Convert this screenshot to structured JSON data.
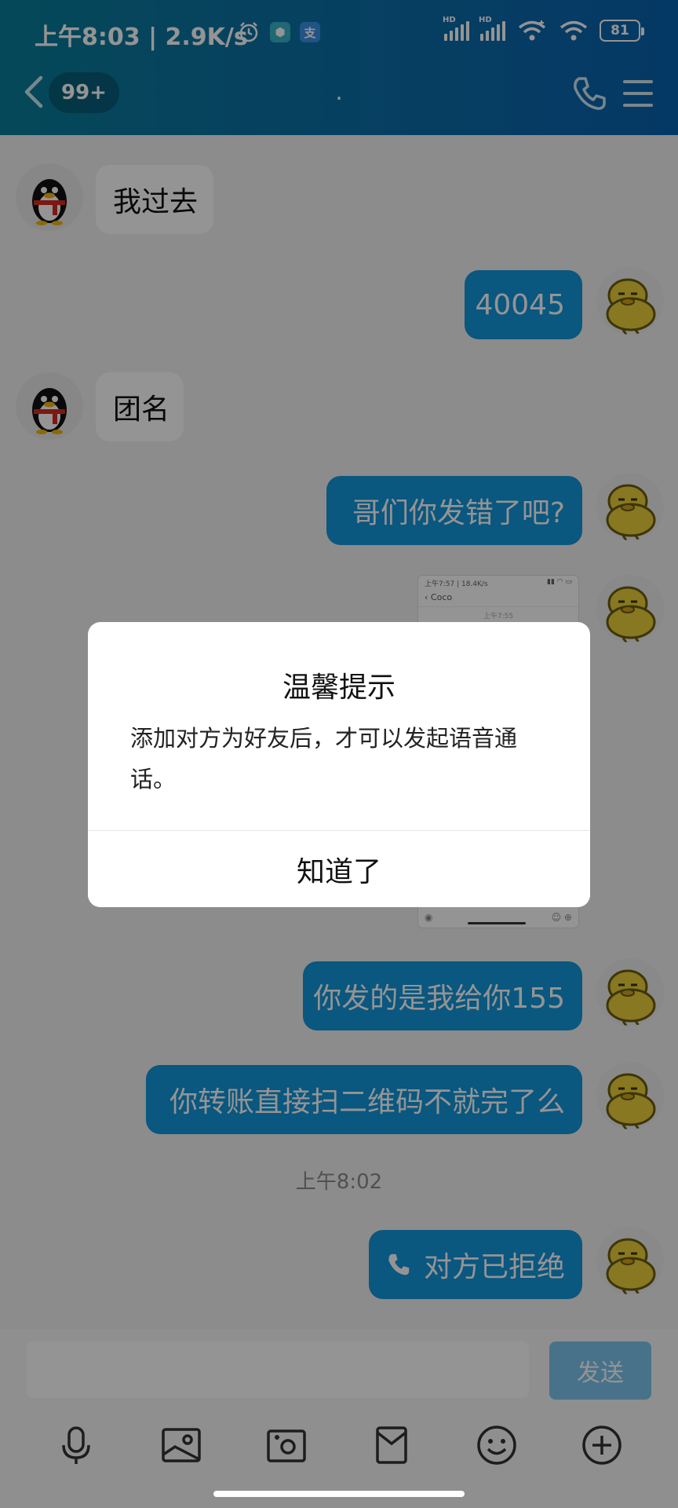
{
  "status_bar": {
    "time_speed": "上午8:03 | 2.9K/s",
    "app1_icon": "shield-app-icon",
    "app2_icon": "alipay-icon",
    "network_labels": [
      "HD",
      "HD"
    ],
    "battery": "81"
  },
  "header": {
    "unread_badge": "99+",
    "title": ".",
    "phone_icon": "phone-icon",
    "menu_icon": "menu-icon"
  },
  "messages": [
    {
      "side": "in",
      "text": "我过去"
    },
    {
      "side": "out",
      "text": "40045"
    },
    {
      "side": "in",
      "text": "团名"
    },
    {
      "side": "out",
      "text": "哥们你发错了吧?"
    },
    {
      "side": "out",
      "type": "image",
      "image_title": "Coco",
      "image_status": "上午7:57 | 18.4K/s",
      "image_time": "上午7:55"
    },
    {
      "side": "out",
      "text": "你发的是我给你155"
    },
    {
      "side": "out",
      "text": "你转账直接扫二维码不就完了么"
    },
    {
      "side": "out",
      "text": "对方已拒绝",
      "icon": "phone-icon"
    }
  ],
  "timestamp": "上午8:02",
  "input": {
    "placeholder": "",
    "send_label": "发送"
  },
  "toolbar": [
    "microphone-icon",
    "image-icon",
    "camera-icon",
    "red-packet-icon",
    "emoji-icon",
    "plus-icon"
  ],
  "dialog": {
    "title": "温馨提示",
    "message": "添加对方为好友后，才可以发起语音通话。",
    "button": "知道了"
  },
  "colors": {
    "header": "#0a6fa8",
    "bubble_out": "#1296db",
    "send": "#7dc4ee"
  }
}
